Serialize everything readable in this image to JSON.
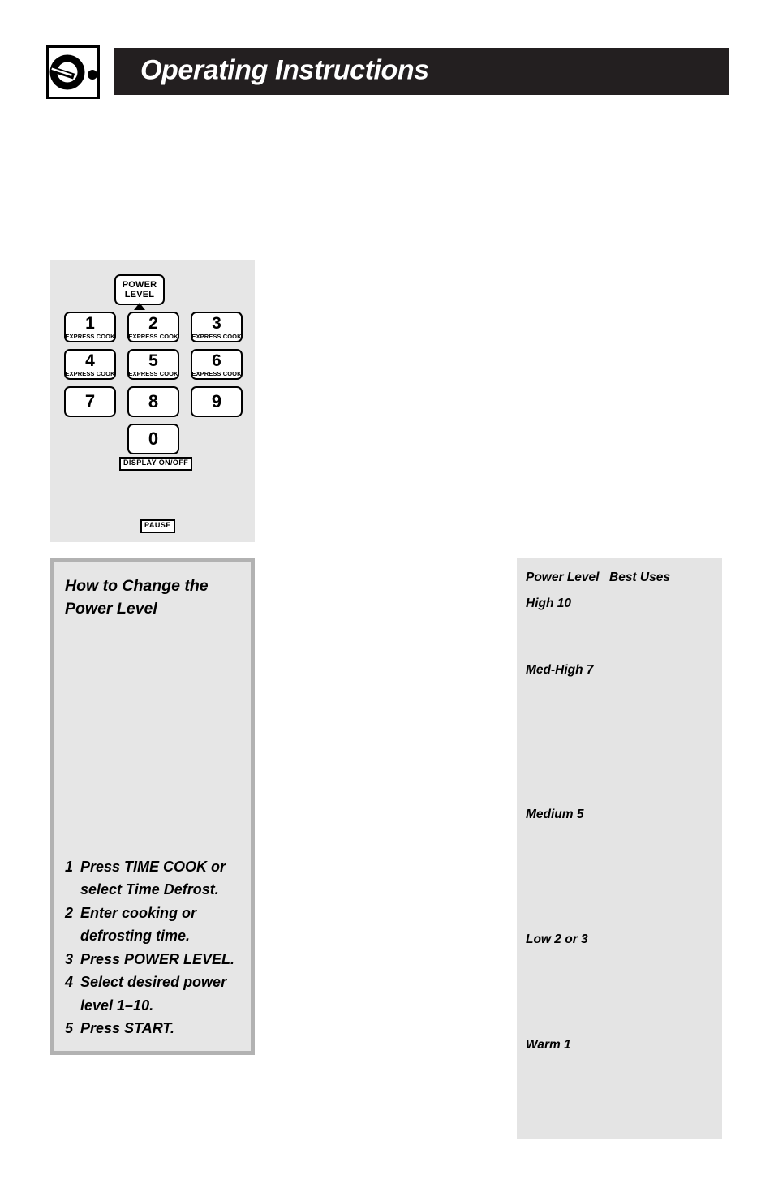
{
  "header": {
    "title": "Operating Instructions",
    "logo_icon": "dial-knob-icon"
  },
  "keypad": {
    "power_level_key": {
      "line1": "POWER",
      "line2": "LEVEL"
    },
    "keys": [
      {
        "digit": "1",
        "sub": "EXPRESS COOK"
      },
      {
        "digit": "2",
        "sub": "EXPRESS COOK"
      },
      {
        "digit": "3",
        "sub": "EXPRESS COOK"
      },
      {
        "digit": "4",
        "sub": "EXPRESS COOK"
      },
      {
        "digit": "5",
        "sub": "EXPRESS COOK"
      },
      {
        "digit": "6",
        "sub": "EXPRESS COOK"
      },
      {
        "digit": "7",
        "sub": ""
      },
      {
        "digit": "8",
        "sub": ""
      },
      {
        "digit": "9",
        "sub": ""
      },
      {
        "digit": "0",
        "sub": ""
      }
    ],
    "display_on_off_label": "DISPLAY ON/OFF",
    "pause_label": "PAUSE"
  },
  "instructions": {
    "heading_line1": "How to Change the",
    "heading_line2": "Power Level",
    "steps": [
      {
        "num": "1",
        "text": "Press TIME COOK or select Time Defrost."
      },
      {
        "num": "2",
        "text": "Enter cooking or defrosting time."
      },
      {
        "num": "3",
        "text": "Press POWER LEVEL."
      },
      {
        "num": "4",
        "text": "Select desired power level 1–10."
      },
      {
        "num": "5",
        "text": "Press START."
      }
    ]
  },
  "power_table": {
    "header": {
      "level": "Power Level",
      "uses": "Best Uses"
    },
    "rows": [
      {
        "level": "High 10",
        "uses": ""
      },
      {
        "level": "Med-High 7",
        "uses": ""
      },
      {
        "level": "Medium 5",
        "uses": ""
      },
      {
        "level": "Low 2 or 3",
        "uses": ""
      },
      {
        "level": "Warm 1",
        "uses": ""
      }
    ]
  },
  "colors": {
    "banner_bg": "#231f20",
    "panel_bg": "#e6e6e6",
    "table_bg": "#e4e4e4",
    "panel_border": "#b2b2b2"
  }
}
